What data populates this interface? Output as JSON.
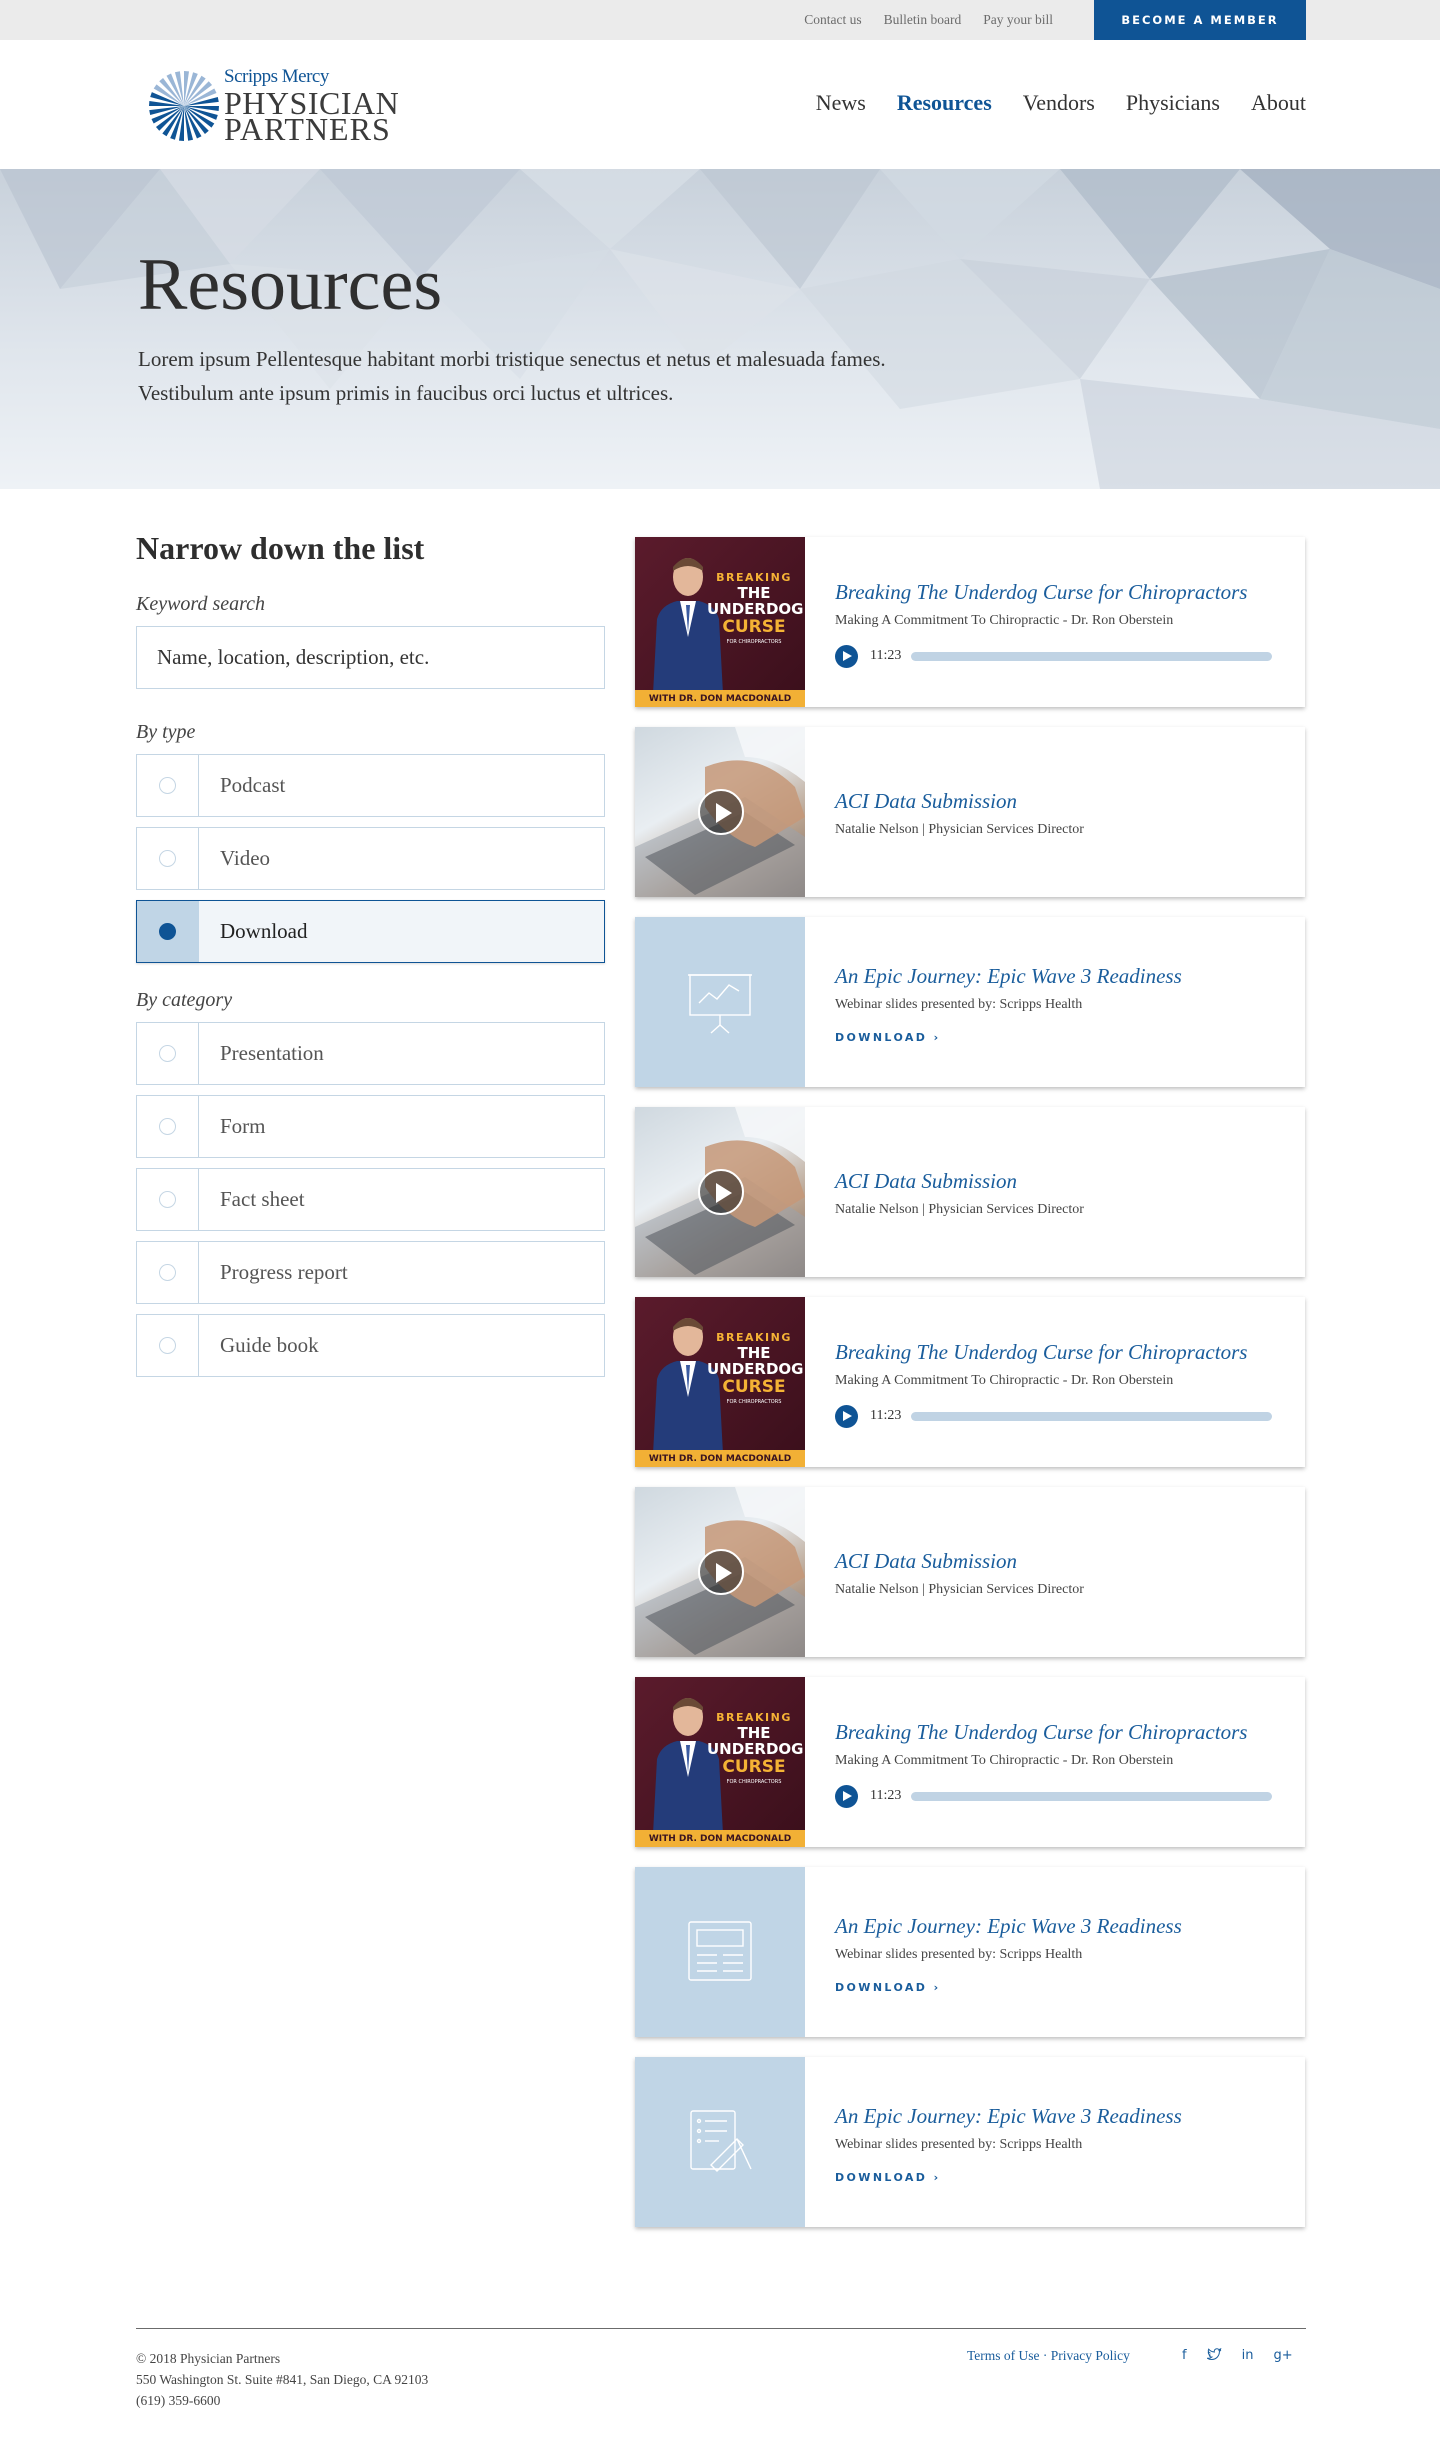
{
  "topbar": {
    "links": [
      "Contact us",
      "Bulletin board",
      "Pay your bill"
    ],
    "cta": "BECOME A MEMBER"
  },
  "logo": {
    "line1": "Scripps Mercy",
    "line2": "PHYSICIAN",
    "line3": "PARTNERS"
  },
  "nav": {
    "items": [
      "News",
      "Resources",
      "Vendors",
      "Physicians",
      "About"
    ],
    "active": "Resources"
  },
  "hero": {
    "title": "Resources",
    "line1": "Lorem ipsum Pellentesque habitant morbi tristique senectus et netus et malesuada fames.",
    "line2": "Vestibulum ante ipsum primis in faucibus orci luctus et ultrices."
  },
  "filters": {
    "heading": "Narrow down the list",
    "keyword_label": "Keyword search",
    "keyword_placeholder": "Name, location, description, etc.",
    "type_label": "By type",
    "types": [
      "Podcast",
      "Video",
      "Download"
    ],
    "selected_type": "Download",
    "category_label": "By category",
    "categories": [
      "Presentation",
      "Form",
      "Fact sheet",
      "Progress report",
      "Guide book"
    ]
  },
  "podcast_art": {
    "t1": "BREAKING",
    "t2": "THE",
    "t3": "UNDERDOG",
    "t4": "CURSE",
    "t5": "FOR CHIROPRACTORS",
    "band": "WITH DR. DON MACDONALD"
  },
  "cards": [
    {
      "kind": "podcast",
      "title": "Breaking The Underdog Curse for Chiropractors",
      "sub": "Making A Commitment To Chiropractic - Dr. Ron Oberstein",
      "time": "11:23"
    },
    {
      "kind": "video",
      "title": "ACI Data Submission",
      "sub": "Natalie Nelson | Physician Services Director"
    },
    {
      "kind": "download",
      "icon": "presentation-icon",
      "title": "An Epic Journey: Epic Wave 3 Readiness",
      "sub": "Webinar slides presented by: Scripps Health",
      "action": "DOWNLOAD ›"
    },
    {
      "kind": "video",
      "title": "ACI Data Submission",
      "sub": "Natalie Nelson | Physician Services Director"
    },
    {
      "kind": "podcast",
      "title": "Breaking The Underdog Curse for Chiropractors",
      "sub": "Making A Commitment To Chiropractic - Dr. Ron Oberstein",
      "time": "11:23"
    },
    {
      "kind": "video",
      "title": "ACI Data Submission",
      "sub": "Natalie Nelson | Physician Services Director"
    },
    {
      "kind": "podcast",
      "title": "Breaking The Underdog Curse for Chiropractors",
      "sub": "Making A Commitment To Chiropractic - Dr. Ron Oberstein",
      "time": "11:23"
    },
    {
      "kind": "download",
      "icon": "document-icon",
      "title": "An Epic Journey: Epic Wave 3 Readiness",
      "sub": "Webinar slides presented by: Scripps Health",
      "action": "DOWNLOAD ›"
    },
    {
      "kind": "download",
      "icon": "form-icon",
      "title": "An Epic Journey: Epic Wave 3 Readiness",
      "sub": "Webinar slides presented by: Scripps Health",
      "action": "DOWNLOAD ›"
    }
  ],
  "footer": {
    "copyright": "© 2018 Physician Partners",
    "address": "550 Washington St. Suite #841, San Diego, CA 92103",
    "phone": "(619) 359-6600",
    "terms": "Terms of Use",
    "sep": " · ",
    "privacy": "Privacy Policy",
    "social": [
      "facebook-icon",
      "twitter-icon",
      "linkedin-icon",
      "google-plus-icon"
    ]
  },
  "colors": {
    "brand": "#0f5495",
    "link": "#1a5d9c",
    "thumb_bg": "#c0d5e6"
  }
}
